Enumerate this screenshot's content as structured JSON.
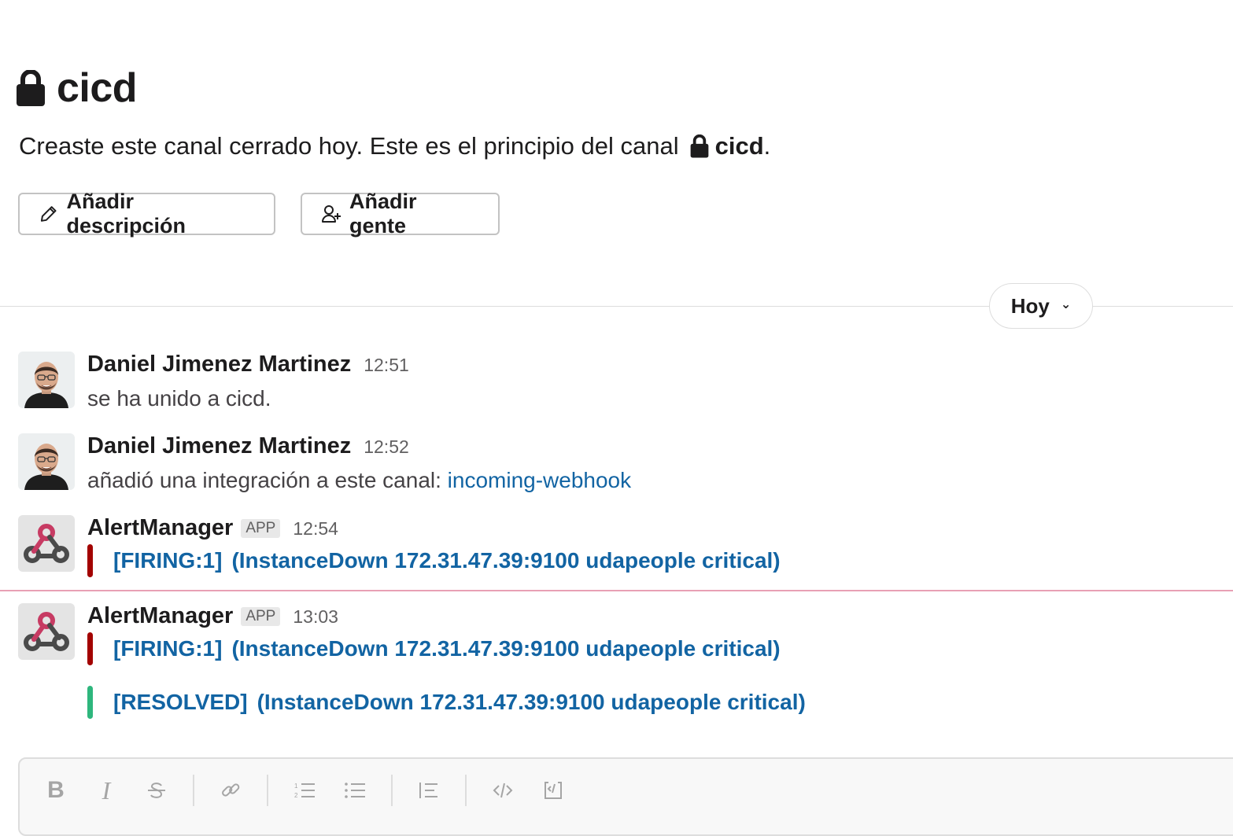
{
  "channel": {
    "name": "cicd",
    "intro_prefix": "Creaste este canal cerrado hoy. Este es el principio del canal",
    "intro_channel": "cicd",
    "intro_suffix": "."
  },
  "actions": {
    "add_description": "Añadir descripción",
    "add_people": "Añadir gente"
  },
  "day_divider": {
    "label": "Hoy",
    "icon": "chevron-down-icon"
  },
  "messages": [
    {
      "author": "Daniel Jimenez Martinez",
      "time": "12:51",
      "text": "se ha unido a cicd."
    },
    {
      "author": "Daniel Jimenez Martinez",
      "time": "12:52",
      "text": "añadió una integración a este canal:",
      "link": "incoming-webhook"
    },
    {
      "author": "AlertManager",
      "badge": "APP",
      "time": "12:54",
      "attachments": [
        {
          "status": "[FIRING:1]",
          "detail": "(InstanceDown 172.31.47.39:9100 udapeople critical)",
          "color": "#a30200"
        }
      ]
    },
    {
      "author": "AlertManager",
      "badge": "APP",
      "time": "13:03",
      "attachments": [
        {
          "status": "[FIRING:1]",
          "detail": "(InstanceDown 172.31.47.39:9100 udapeople critical)",
          "color": "#a30200"
        },
        {
          "status": "[RESOLVED]",
          "detail": "(InstanceDown 172.31.47.39:9100 udapeople critical)",
          "color": "#2eb67d"
        }
      ]
    }
  ],
  "composer": {
    "toolbar": [
      "bold-icon",
      "italic-icon",
      "strikethrough-icon",
      "link-icon",
      "ordered-list-icon",
      "bulleted-list-icon",
      "blockquote-icon",
      "code-icon",
      "code-block-icon"
    ],
    "bold_glyph": "B",
    "italic_glyph": "I"
  },
  "colors": {
    "link": "#1264a3",
    "firing": "#a30200",
    "resolved": "#2eb67d",
    "new_message_divider": "#e8a0b4"
  }
}
